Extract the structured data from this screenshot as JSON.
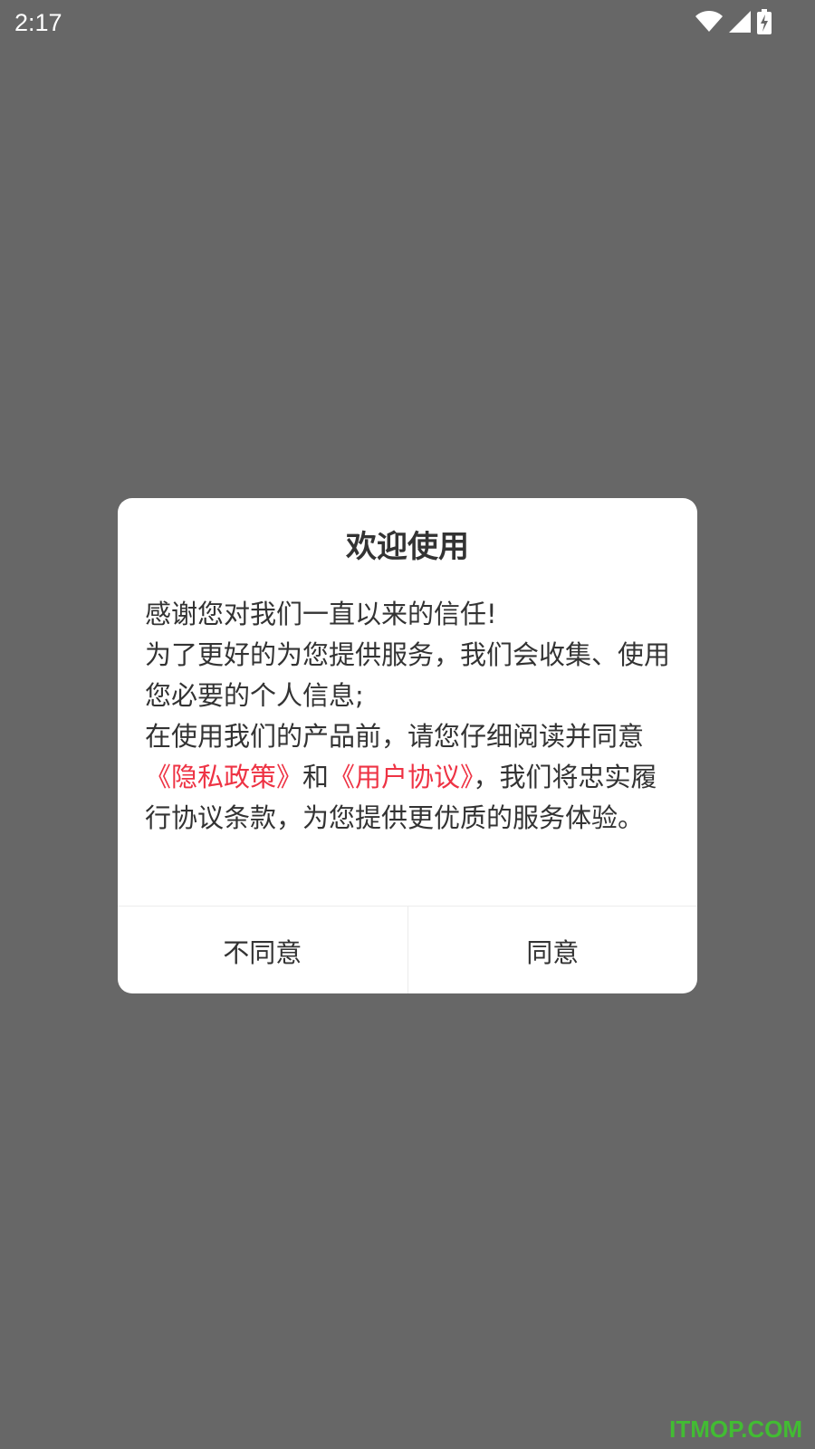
{
  "status_bar": {
    "time": "2:17",
    "icons": [
      "wifi-icon",
      "cell-signal-icon",
      "battery-charging-icon"
    ]
  },
  "dialog": {
    "title": "欢迎使用",
    "line1": "感谢您对我们一直以来的信任!",
    "line2": "为了更好的为您提供服务，我们会收集、使用您必要的个人信息;",
    "line3_prefix": "在使用我们的产品前，请您仔细阅读并同意",
    "privacy_link": "《隐私政策》",
    "and_text": "和",
    "user_agreement_link": "《用户协议》",
    "line3_suffix": "，我们将忠实履行协议条款，为您提供更优质的服务体验。",
    "disagree_label": "不同意",
    "agree_label": "同意"
  },
  "watermark": "ITMOP.COM",
  "colors": {
    "backdrop": "#676767",
    "link": "#ee3344",
    "text": "#333333",
    "watermark": "#3ccb2a"
  }
}
